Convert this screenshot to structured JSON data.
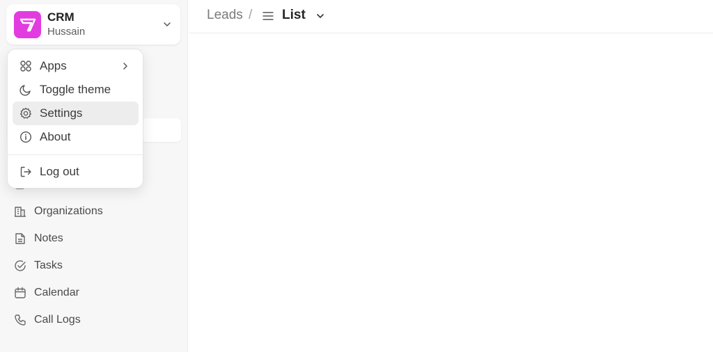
{
  "app": {
    "name": "CRM",
    "user": "Hussain",
    "brand_color": "#e23ce0"
  },
  "breadcrumb": {
    "parent": "Leads",
    "separator": "/",
    "current": "List",
    "current_icon": "list-icon"
  },
  "menu": {
    "items": [
      {
        "label": "Apps",
        "icon": "apps-grid-icon",
        "has_submenu": true
      },
      {
        "label": "Toggle theme",
        "icon": "moon-icon"
      },
      {
        "label": "Settings",
        "icon": "gear-icon",
        "highlighted": true
      },
      {
        "label": "About",
        "icon": "info-icon"
      },
      {
        "label": "Log out",
        "icon": "logout-icon"
      }
    ]
  },
  "sidebar": {
    "items": [
      {
        "label": "Organizations",
        "icon": "building-icon"
      },
      {
        "label": "Notes",
        "icon": "note-icon"
      },
      {
        "label": "Tasks",
        "icon": "check-circle-icon"
      },
      {
        "label": "Calendar",
        "icon": "calendar-icon"
      },
      {
        "label": "Call Logs",
        "icon": "phone-icon"
      }
    ]
  }
}
